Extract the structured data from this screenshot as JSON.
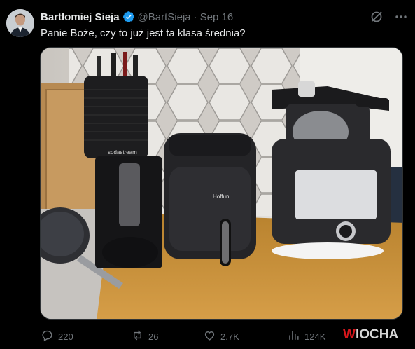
{
  "author": {
    "display_name": "Bartłomiej Sieja",
    "handle": "@BartSieja",
    "separator": "·",
    "date": "Sep 16"
  },
  "tweet": {
    "text": "Panie Boże, czy to już jest ta klasa średnia?"
  },
  "media": {
    "appliance_brands": [
      "sodastream",
      "Hoffun"
    ]
  },
  "actions": {
    "replies": "220",
    "reposts": "26",
    "likes": "2.7K",
    "views": "124K"
  },
  "watermark": {
    "first": "W",
    "rest": "IOCHA"
  },
  "colors": {
    "background": "#000000",
    "text_primary": "#e7e9ea",
    "text_secondary": "#71767b",
    "verified": "#1d9bf0",
    "watermark_accent": "#d8161b"
  },
  "icons": [
    "verified-badge-icon",
    "grok-icon",
    "more-icon",
    "reply-icon",
    "repost-icon",
    "like-icon",
    "views-icon"
  ]
}
